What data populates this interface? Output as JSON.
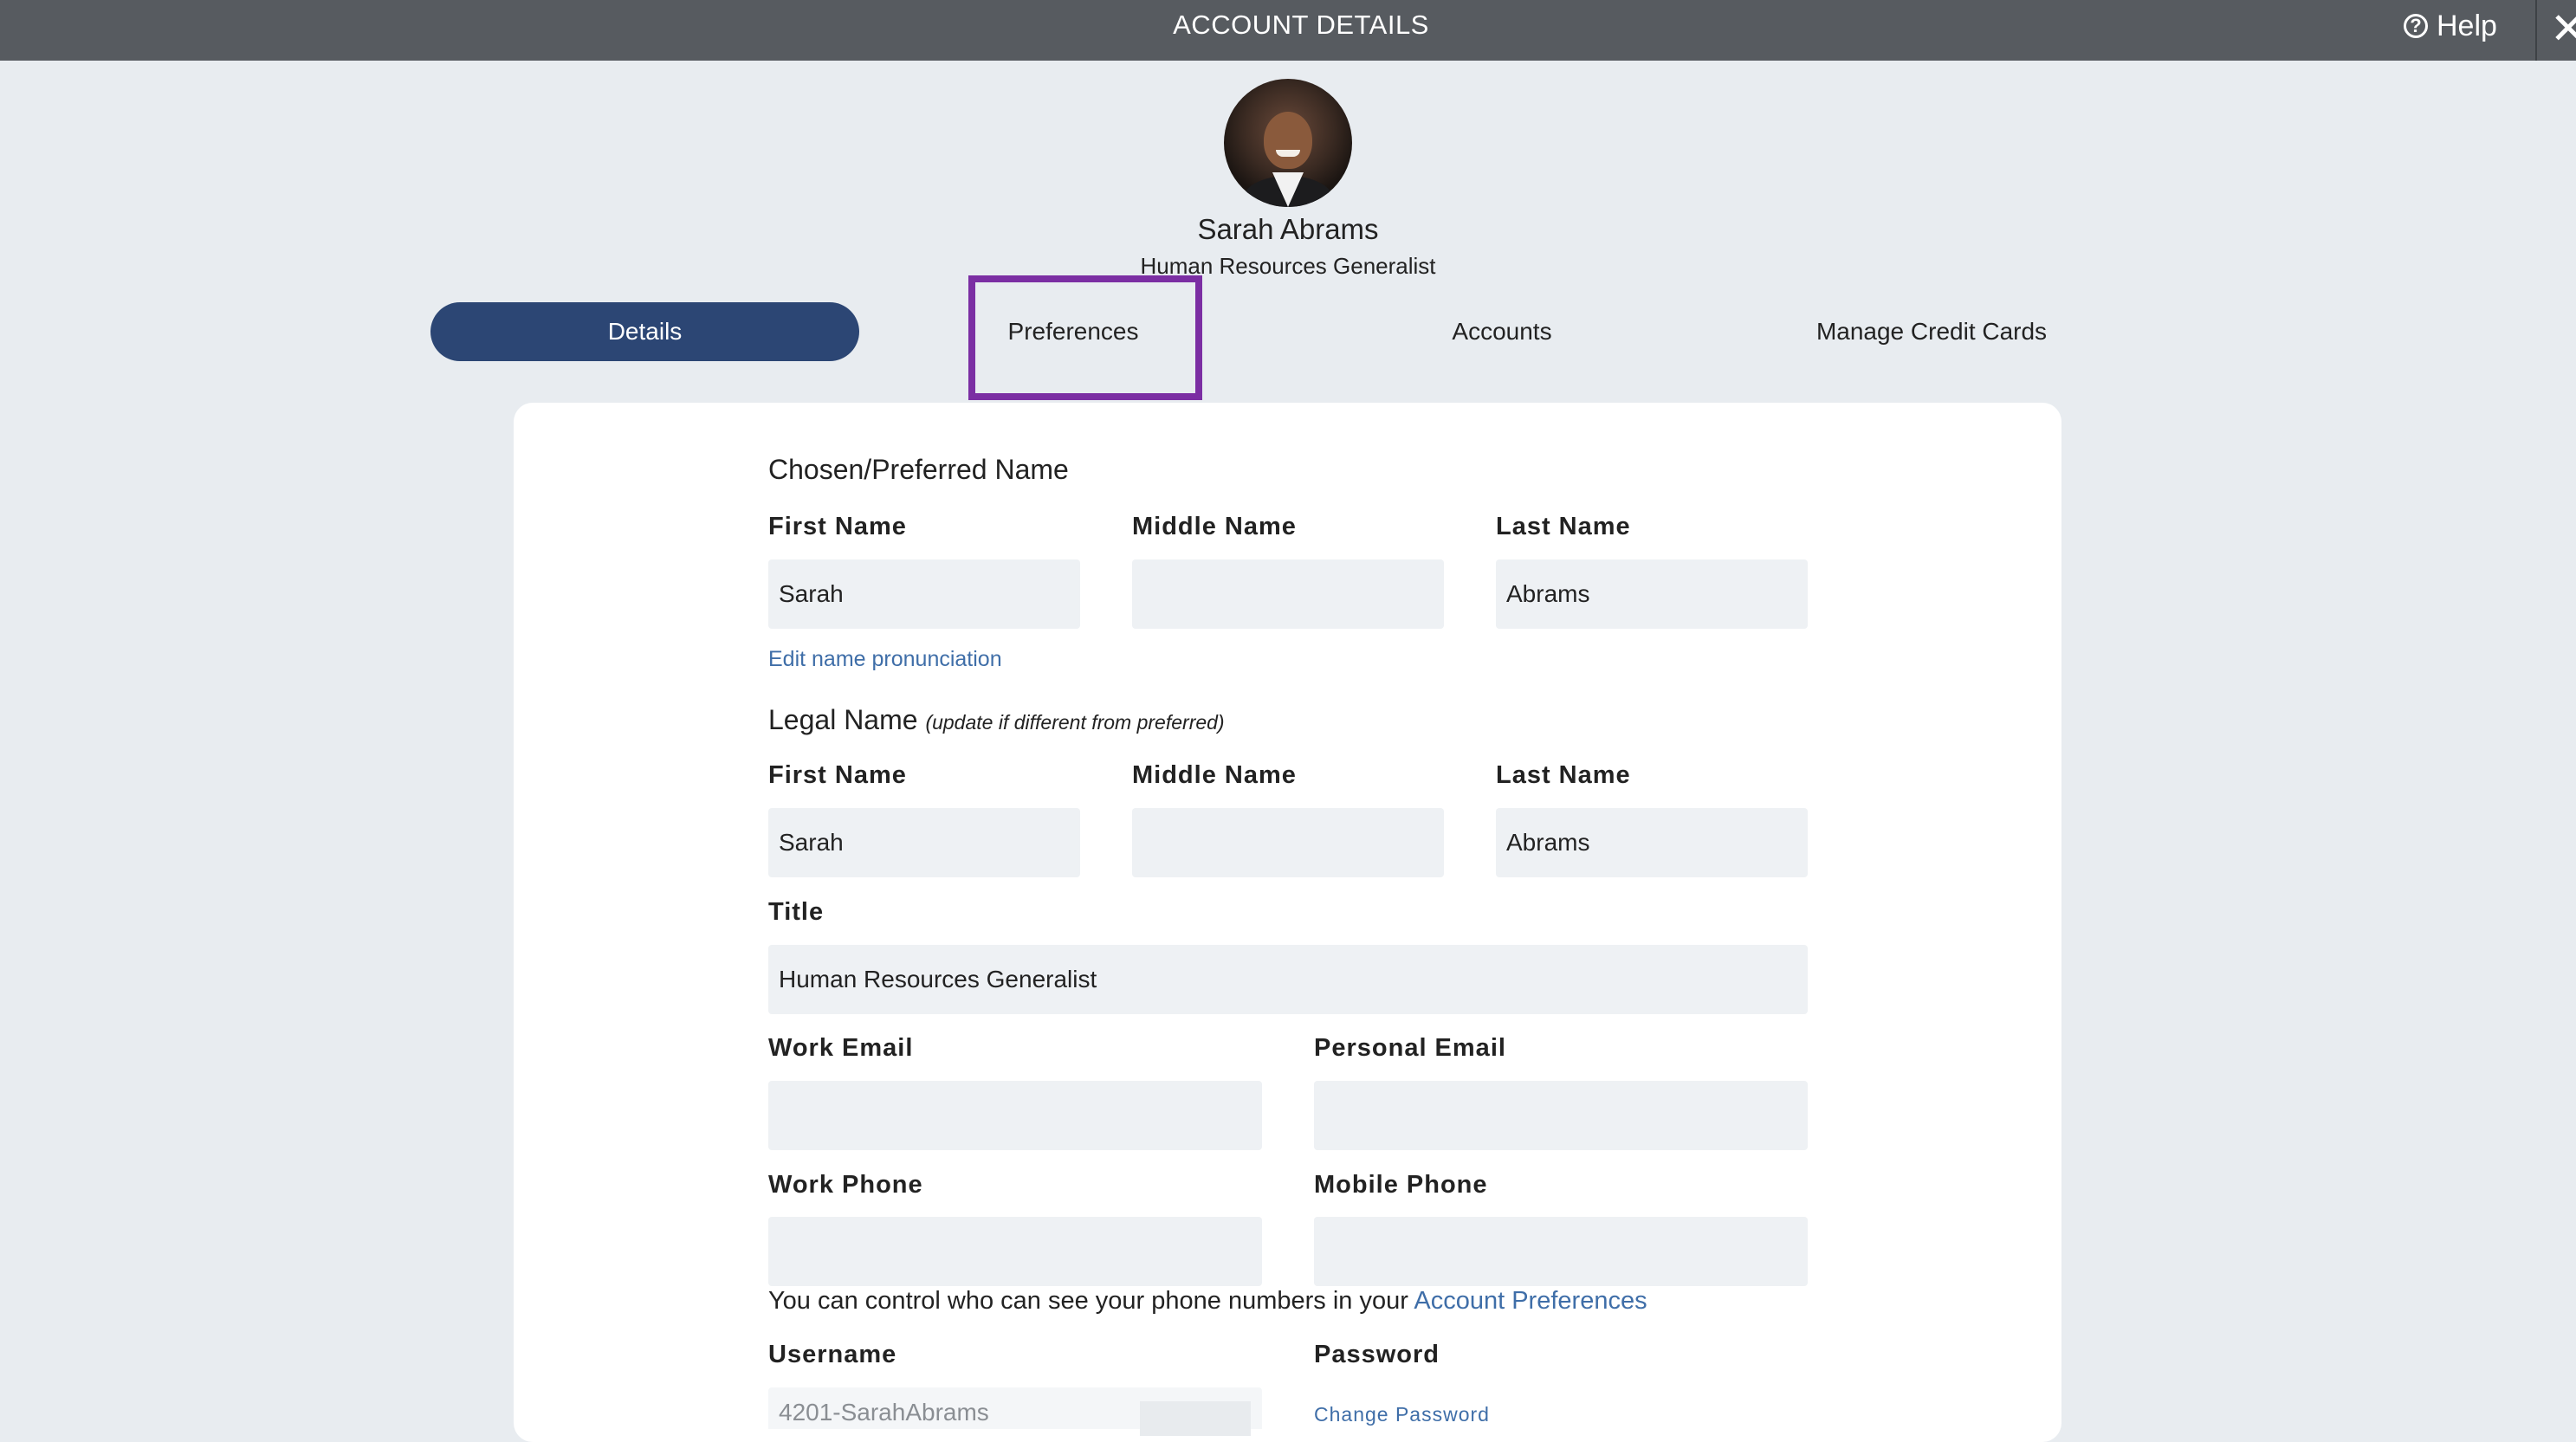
{
  "window": {
    "title": "ACCOUNT DETAILS",
    "help_label": "Help",
    "close_glyph": "✕"
  },
  "profile": {
    "name": "Sarah Abrams",
    "job_title": "Human Resources Generalist",
    "avatar_alt": "Profile photo"
  },
  "tabs": [
    {
      "label": "Details",
      "active": true
    },
    {
      "label": "Preferences",
      "active": false,
      "highlighted": true
    },
    {
      "label": "Accounts",
      "active": false
    },
    {
      "label": "Manage Credit Cards",
      "active": false
    }
  ],
  "preferred_name": {
    "heading": "Chosen/Preferred Name",
    "first_label": "First Name",
    "middle_label": "Middle Name",
    "last_label": "Last Name",
    "first_value": "Sarah",
    "middle_value": "",
    "last_value": "Abrams",
    "pronunciation_link": "Edit name pronunciation"
  },
  "legal_name": {
    "heading": "Legal Name",
    "hint": "(update if different from preferred)",
    "first_label": "First Name",
    "middle_label": "Middle Name",
    "last_label": "Last Name",
    "first_value": "Sarah",
    "middle_value": "",
    "last_value": "Abrams"
  },
  "title_field": {
    "label": "Title",
    "value": "Human Resources Generalist"
  },
  "contact": {
    "work_email_label": "Work Email",
    "work_email_value": "",
    "personal_email_label": "Personal Email",
    "personal_email_value": "",
    "work_phone_label": "Work Phone",
    "work_phone_value": "",
    "mobile_phone_label": "Mobile Phone",
    "mobile_phone_value": "",
    "phone_note": "You can control who can see your phone numbers in your",
    "phone_note_link": "Account Preferences"
  },
  "credentials": {
    "username_label": "Username",
    "username_value": "4201-SarahAbrams",
    "password_label": "Password",
    "change_password_link": "Change Password"
  },
  "colors": {
    "topbar": "#575b60",
    "active_tab": "#2c4674",
    "highlight": "#7b2ea3",
    "link": "#3f6ea8",
    "background": "#e8ecf0"
  }
}
